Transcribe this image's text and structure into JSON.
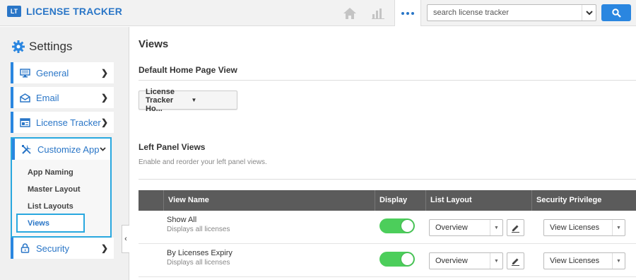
{
  "app": {
    "logo_badge": "LT",
    "title": "LICENSE TRACKER",
    "accent": "#2a76c7"
  },
  "topnav": {
    "search_placeholder": "search license tracker"
  },
  "sidebar": {
    "title": "Settings",
    "items": [
      {
        "label": "General",
        "icon": "monitor-icon"
      },
      {
        "label": "Email",
        "icon": "envelope-icon"
      },
      {
        "label": "License Tracker",
        "icon": "window-icon"
      },
      {
        "label": "Customize App",
        "icon": "tools-icon"
      },
      {
        "label": "Security",
        "icon": "lock-icon"
      }
    ],
    "customize_sub": [
      "App Naming",
      "Master Layout",
      "List Layouts",
      "Views"
    ],
    "collapse_glyph": "‹"
  },
  "main": {
    "title": "Views",
    "home_section": "Default Home Page View",
    "home_select": "License Tracker Ho...",
    "left_section": "Left Panel Views",
    "left_desc": "Enable and reorder your left panel views.",
    "columns": [
      "View Name",
      "Display",
      "List Layout",
      "Security Privilege"
    ],
    "rows": [
      {
        "name": "Show All",
        "desc": "Displays all licenses",
        "display": true,
        "layout": "Overview",
        "privilege": "View Licenses"
      },
      {
        "name": "By Licenses Expiry",
        "desc": "Displays all licenses",
        "display": true,
        "layout": "Overview",
        "privilege": "View Licenses"
      }
    ]
  }
}
